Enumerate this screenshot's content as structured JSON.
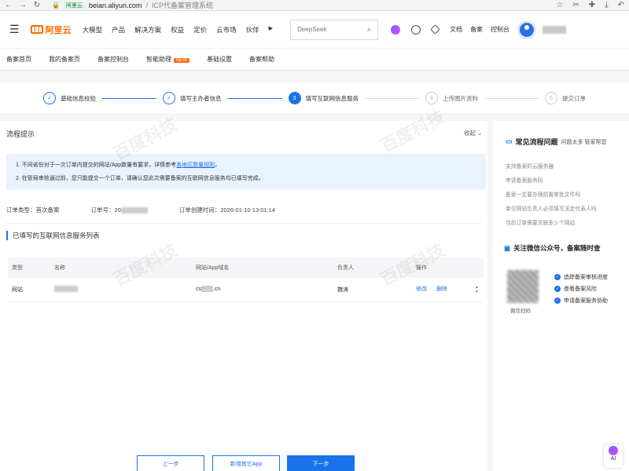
{
  "browser": {
    "site_tag": "阿里云",
    "url_host": "beian.aliyun.com",
    "url_sep": "/",
    "url_title": "ICP代备案管理系统"
  },
  "header": {
    "logo": "阿里云",
    "nav": [
      "大模型",
      "产品",
      "解决方案",
      "权益",
      "定价",
      "云市场",
      "伙伴"
    ],
    "search_placeholder": "DeepSeek",
    "links": [
      "文档",
      "备案",
      "控制台"
    ]
  },
  "subnav": {
    "items": [
      "备案首页",
      "我的备案页",
      "备案控制台",
      "智能助理",
      "基础设置",
      "备案帮助"
    ],
    "new_badge": "NEW"
  },
  "steps": [
    {
      "num": "✓",
      "label": "基础信息校验",
      "state": "done"
    },
    {
      "num": "✓",
      "label": "填写主办者信息",
      "state": "done"
    },
    {
      "num": "3",
      "label": "填写互联网信息服务",
      "state": "active"
    },
    {
      "num": "4",
      "label": "上传图片资料",
      "state": "todo"
    },
    {
      "num": "5",
      "label": "提交订单",
      "state": "todo"
    }
  ],
  "guide": {
    "title": "流程提示",
    "collapse": "收起",
    "line1_a": "1. 不同省份对于一次订单内提交的网站/App数量有要求，详情参考",
    "line1_link": "各地区数量规则",
    "line1_b": "。",
    "line2": "2. 在管局审核通过前，您只能提交一个订单，请确认您此次需要备案的互联网信息服务均已填写完成。"
  },
  "order": {
    "type_label": "订单类型：首次备案",
    "no_label": "订单号：20",
    "time_label": "订单创建时间：2026-01-10 13:01:14"
  },
  "services": {
    "title": "已填写的互联网信息服务列表",
    "headers": [
      "类型",
      "名称",
      "网站/App域名",
      "负责人",
      "操作"
    ],
    "row": {
      "type": "网站",
      "domain": "cs▒▒▒.cn",
      "owner": "魏涛",
      "edit": "修改",
      "delete": "删除"
    }
  },
  "faq": {
    "title": "常见流程问题",
    "subtitle": "问题太多 管家帮您",
    "items": [
      "支持备案的云服务器",
      "申请备案服务码",
      "备案一定要办理前置审批文件吗",
      "单位网站负责人必须填写法定代表人吗",
      "当前订单需要关联多少个网站"
    ]
  },
  "follow": {
    "title": "关注微信公众号，备案随时查",
    "qr_label": "微信扫码",
    "checks": [
      "追踪备案审核进度",
      "查看备案风险",
      "申请备案服务协助"
    ]
  },
  "buttons": {
    "prev": "上一步",
    "add": "新增其它App",
    "next": "下一步",
    "ai": "AI"
  },
  "watermark": "百度科技"
}
